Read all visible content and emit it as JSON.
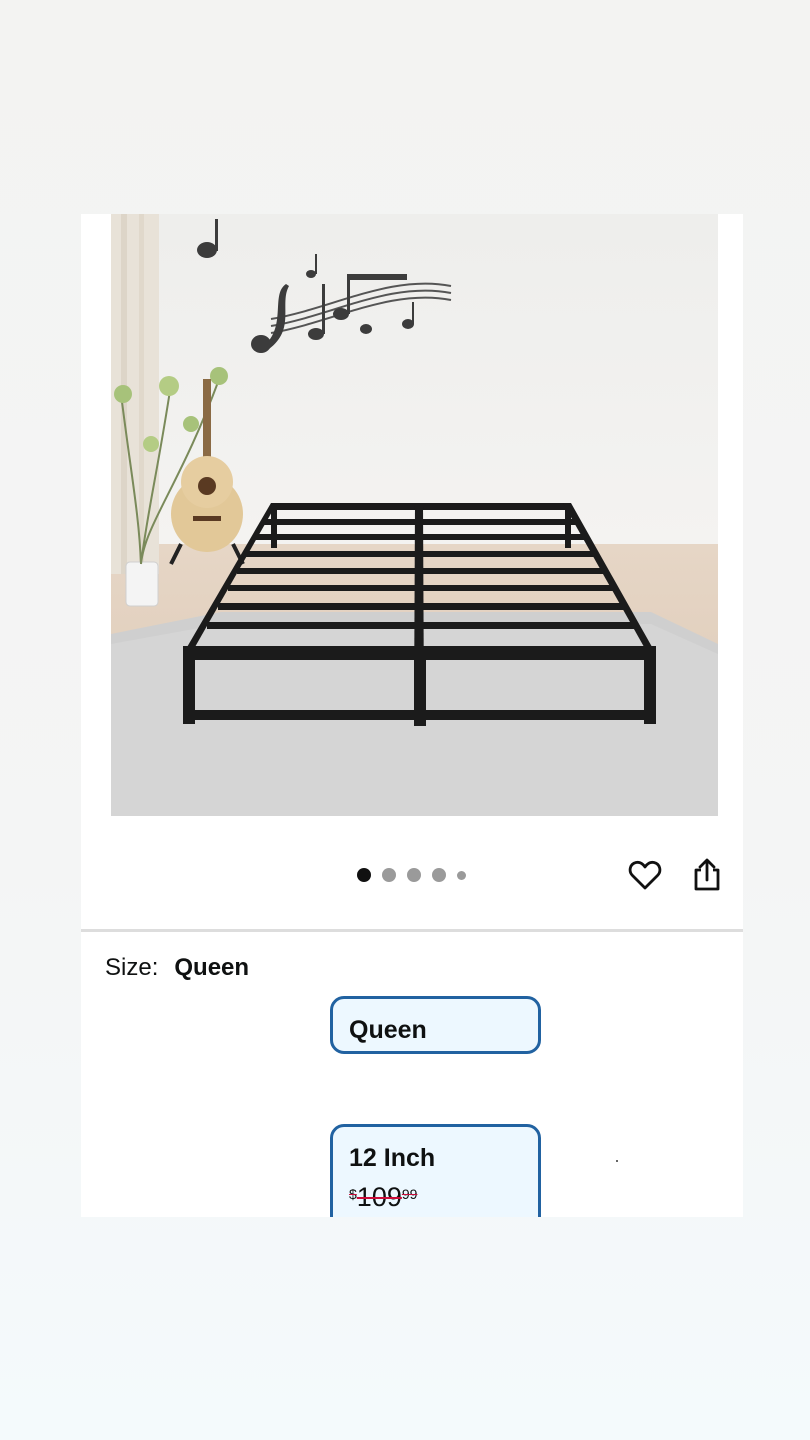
{
  "product_image": {
    "alt": "Black metal platform bed frame"
  },
  "carousel": {
    "total": 5,
    "active_index": 0
  },
  "actions": {
    "wishlist_icon": "heart-outline-icon",
    "share_icon": "share-icon"
  },
  "size": {
    "label": "Size:",
    "selected": "Queen"
  },
  "size_options": [
    {
      "label": "Queen"
    }
  ],
  "style_options": [
    {
      "label": "12 Inch",
      "price_symbol": "$",
      "price_whole": "109",
      "price_fraction": "99"
    }
  ],
  "colors": {
    "accent_border": "#2162a1",
    "selected_bg": "#edf8ff",
    "strike": "#cc0c39"
  }
}
